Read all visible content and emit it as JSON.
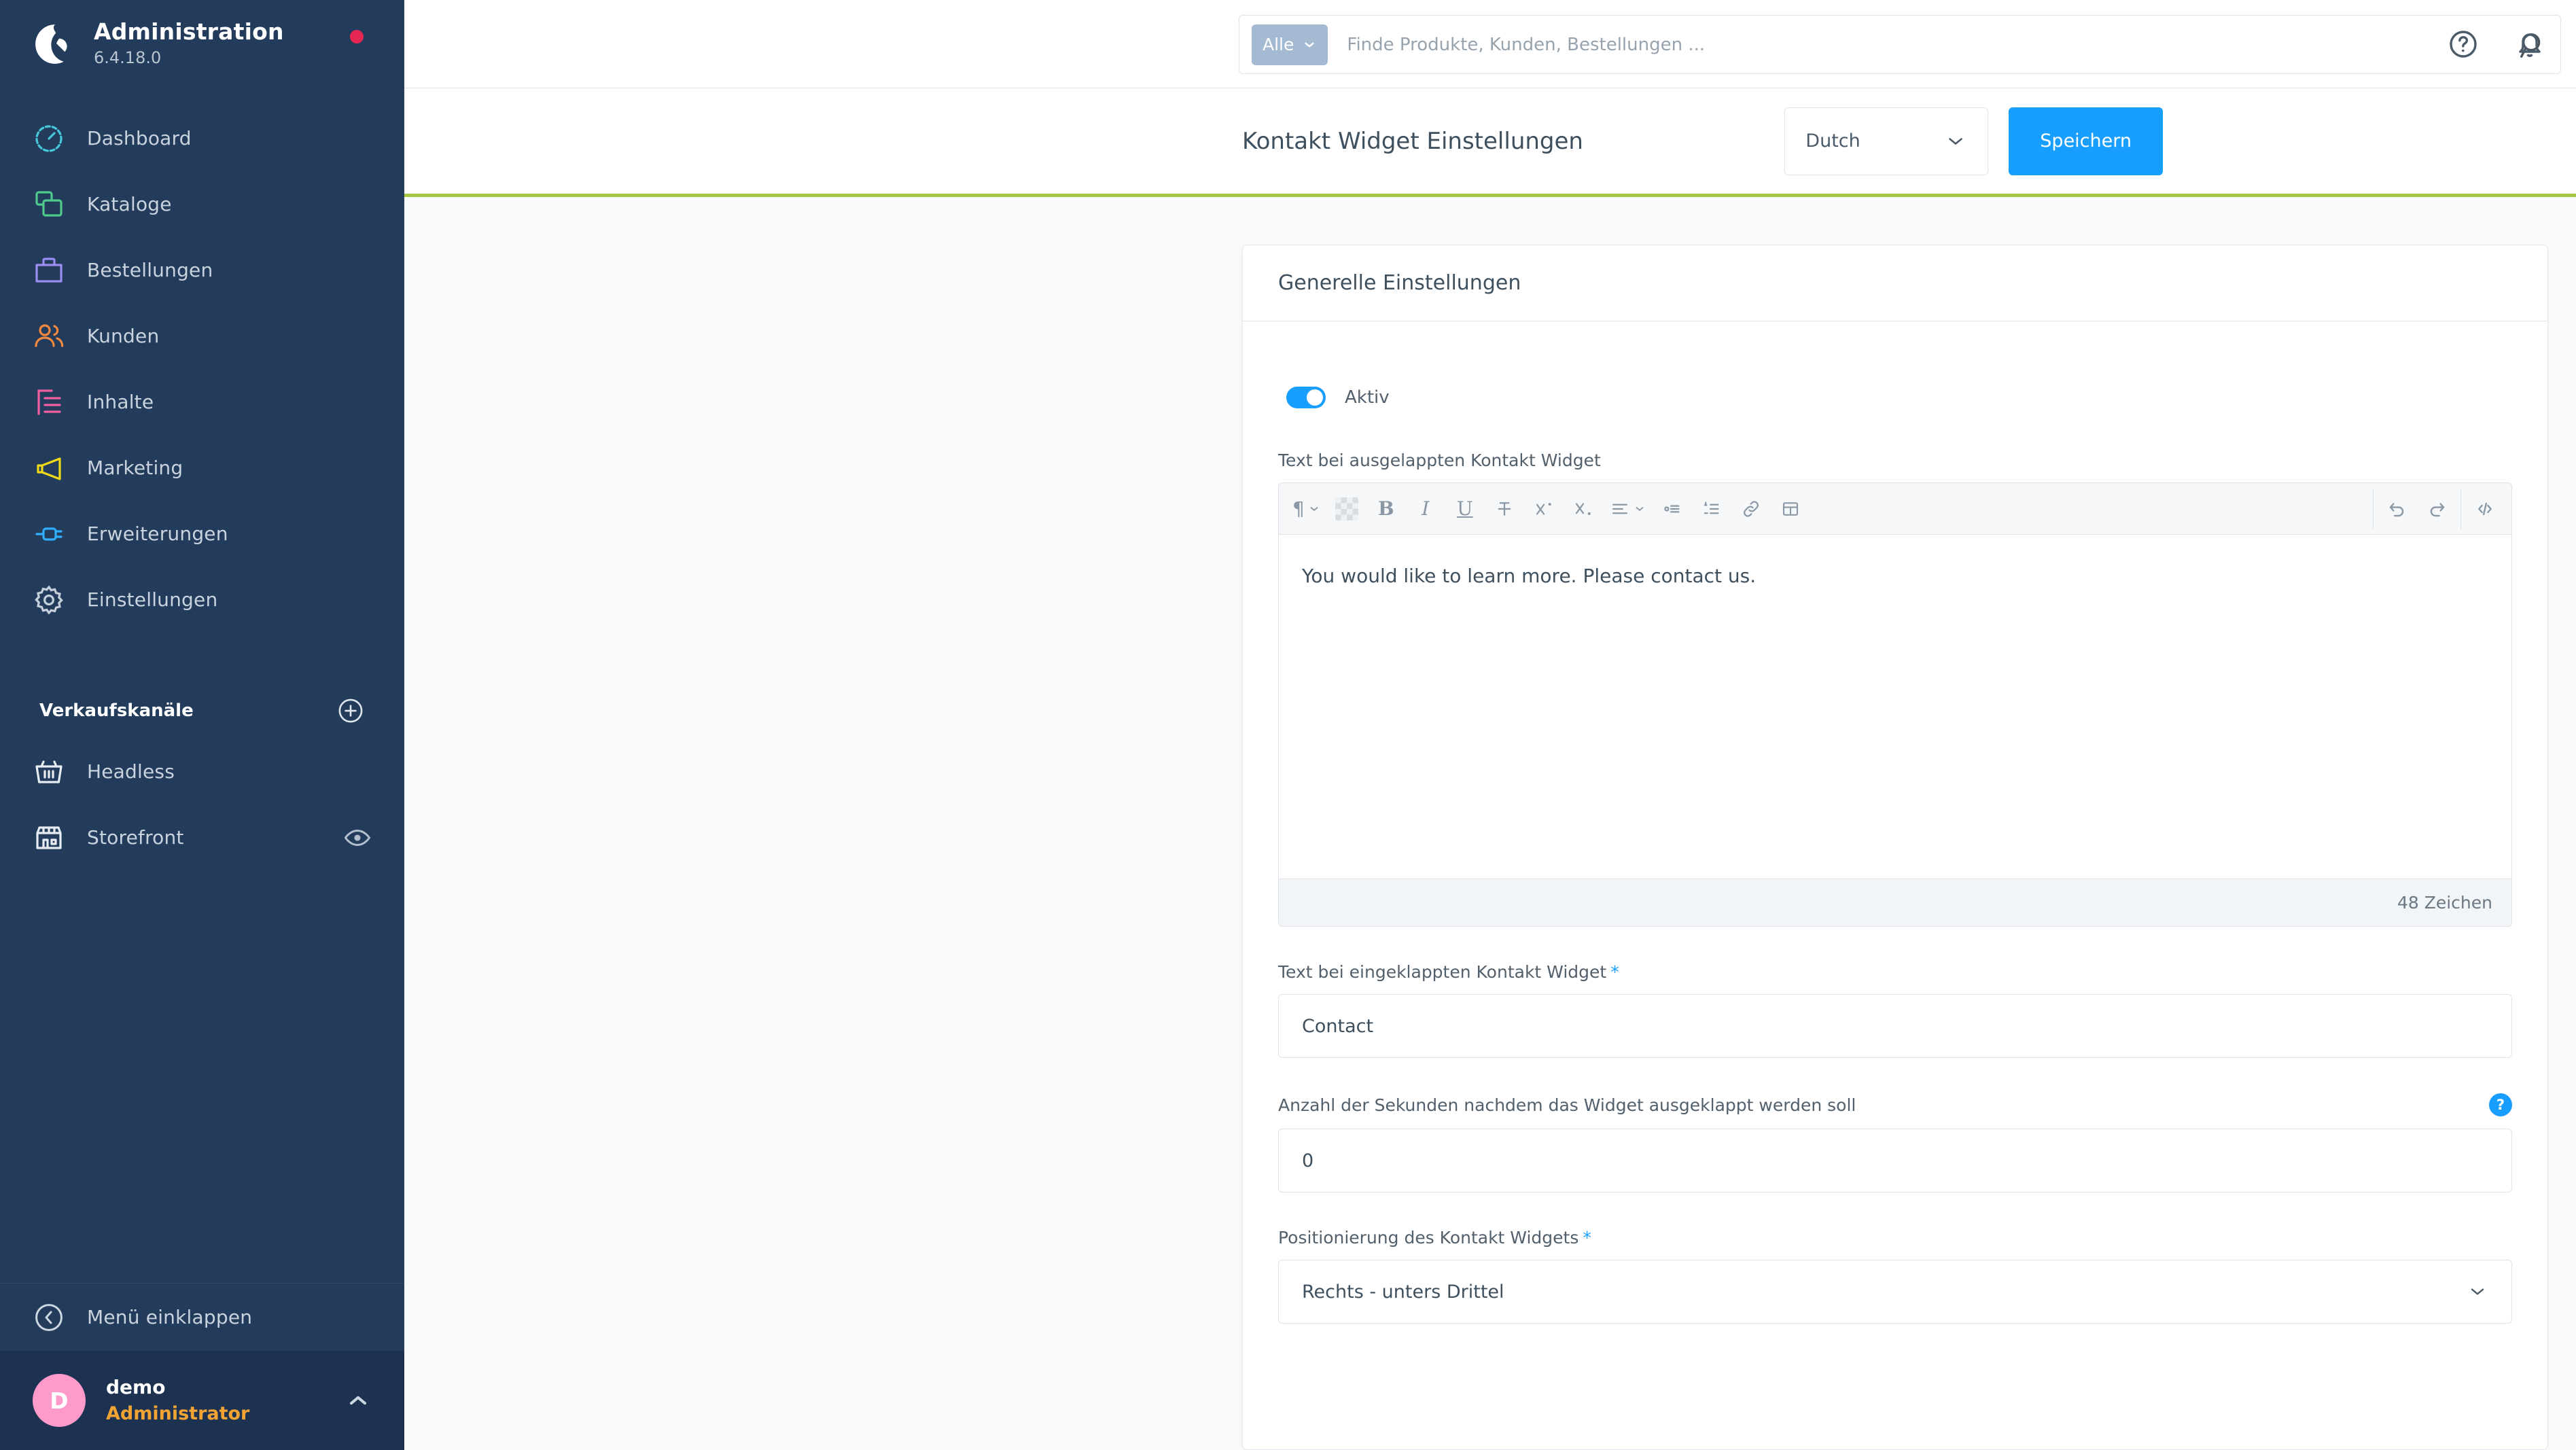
{
  "sidebar": {
    "brand": {
      "title": "Administration",
      "version": "6.4.18.0"
    },
    "nav": [
      {
        "label": "Dashboard",
        "icon": "dashboard-icon",
        "color": "#46c8d9"
      },
      {
        "label": "Kataloge",
        "icon": "catalog-icon",
        "color": "#4ecb8c"
      },
      {
        "label": "Bestellungen",
        "icon": "orders-icon",
        "color": "#9a8cf0"
      },
      {
        "label": "Kunden",
        "icon": "customers-icon",
        "color": "#f2893f"
      },
      {
        "label": "Inhalte",
        "icon": "content-icon",
        "color": "#f25fa0"
      },
      {
        "label": "Marketing",
        "icon": "marketing-icon",
        "color": "#f0d919"
      },
      {
        "label": "Erweiterungen",
        "icon": "extensions-icon",
        "color": "#2eaefd"
      },
      {
        "label": "Einstellungen",
        "icon": "settings-gear-icon",
        "color": "#c6d0da"
      }
    ],
    "sales_channels_title": "Verkaufskanäle",
    "add_channel_icon": "plus-circle-icon",
    "channels": [
      {
        "label": "Headless",
        "icon": "basket-icon",
        "has_eye": false
      },
      {
        "label": "Storefront",
        "icon": "storefront-icon",
        "has_eye": true
      }
    ],
    "collapse_label": "Menü einklappen",
    "collapse_icon": "chevron-left-circle-icon",
    "user": {
      "initial": "D",
      "name": "demo",
      "role": "Administrator",
      "chevron_icon": "chevron-up-icon"
    }
  },
  "topbar": {
    "search_scope": "Alle",
    "search_scope_icon": "chevron-down-icon",
    "search_placeholder": "Finde Produkte, Kunden, Bestellungen ...",
    "search_value": "",
    "search_icon": "search-icon",
    "help_icon": "help-circle-icon",
    "notifications_icon": "bell-icon"
  },
  "pagehead": {
    "title": "Kontakt Widget Einstellungen",
    "language": "Dutch",
    "language_chevron_icon": "chevron-down-icon",
    "save_label": "Speichern",
    "accent_color": "#a3c644"
  },
  "card": {
    "title": "Generelle Einstellungen",
    "toggle": {
      "label": "Aktiv",
      "on": true,
      "color": "#189eff"
    },
    "editor_field": {
      "label": "Text bei ausgelappten Kontakt Widget",
      "content": "You would like to learn more. Please contact us.",
      "char_count": "48 Zeichen",
      "toolbar_left": [
        {
          "name": "paragraph-format-icon",
          "glyph": "¶",
          "has_chevron": true
        },
        {
          "name": "text-color-swatch-icon",
          "glyph": "",
          "has_chevron": false
        },
        {
          "name": "bold-icon",
          "glyph": "B",
          "has_chevron": false
        },
        {
          "name": "italic-icon",
          "glyph": "I",
          "has_chevron": false
        },
        {
          "name": "underline-icon",
          "glyph": "U",
          "has_chevron": false
        },
        {
          "name": "strikethrough-icon",
          "glyph": "",
          "has_chevron": false
        },
        {
          "name": "superscript-icon",
          "glyph": "",
          "has_chevron": false
        },
        {
          "name": "subscript-icon",
          "glyph": "",
          "has_chevron": false
        },
        {
          "name": "text-align-icon",
          "glyph": "",
          "has_chevron": true
        },
        {
          "name": "bullet-list-icon",
          "glyph": "",
          "has_chevron": false
        },
        {
          "name": "ordered-list-icon",
          "glyph": "",
          "has_chevron": false
        },
        {
          "name": "link-icon",
          "glyph": "",
          "has_chevron": false
        },
        {
          "name": "table-icon",
          "glyph": "",
          "has_chevron": false
        }
      ],
      "toolbar_right": [
        {
          "name": "undo-icon"
        },
        {
          "name": "redo-icon"
        },
        {
          "name": "source-code-icon"
        }
      ]
    },
    "collapsed_field": {
      "label": "Text bei eingeklappten Kontakt Widget",
      "required": "*",
      "value": "Contact",
      "placeholder": ""
    },
    "seconds_field": {
      "label": "Anzahl der Sekunden nachdem das Widget ausgeklappt werden soll",
      "value": "0",
      "placeholder": "",
      "help_icon": "help-badge-icon",
      "help_glyph": "?"
    },
    "position_field": {
      "label": "Positionierung des Kontakt Widgets",
      "required": "*",
      "value": "Rechts - unters Drittel",
      "chevron_icon": "chevron-down-icon"
    }
  }
}
